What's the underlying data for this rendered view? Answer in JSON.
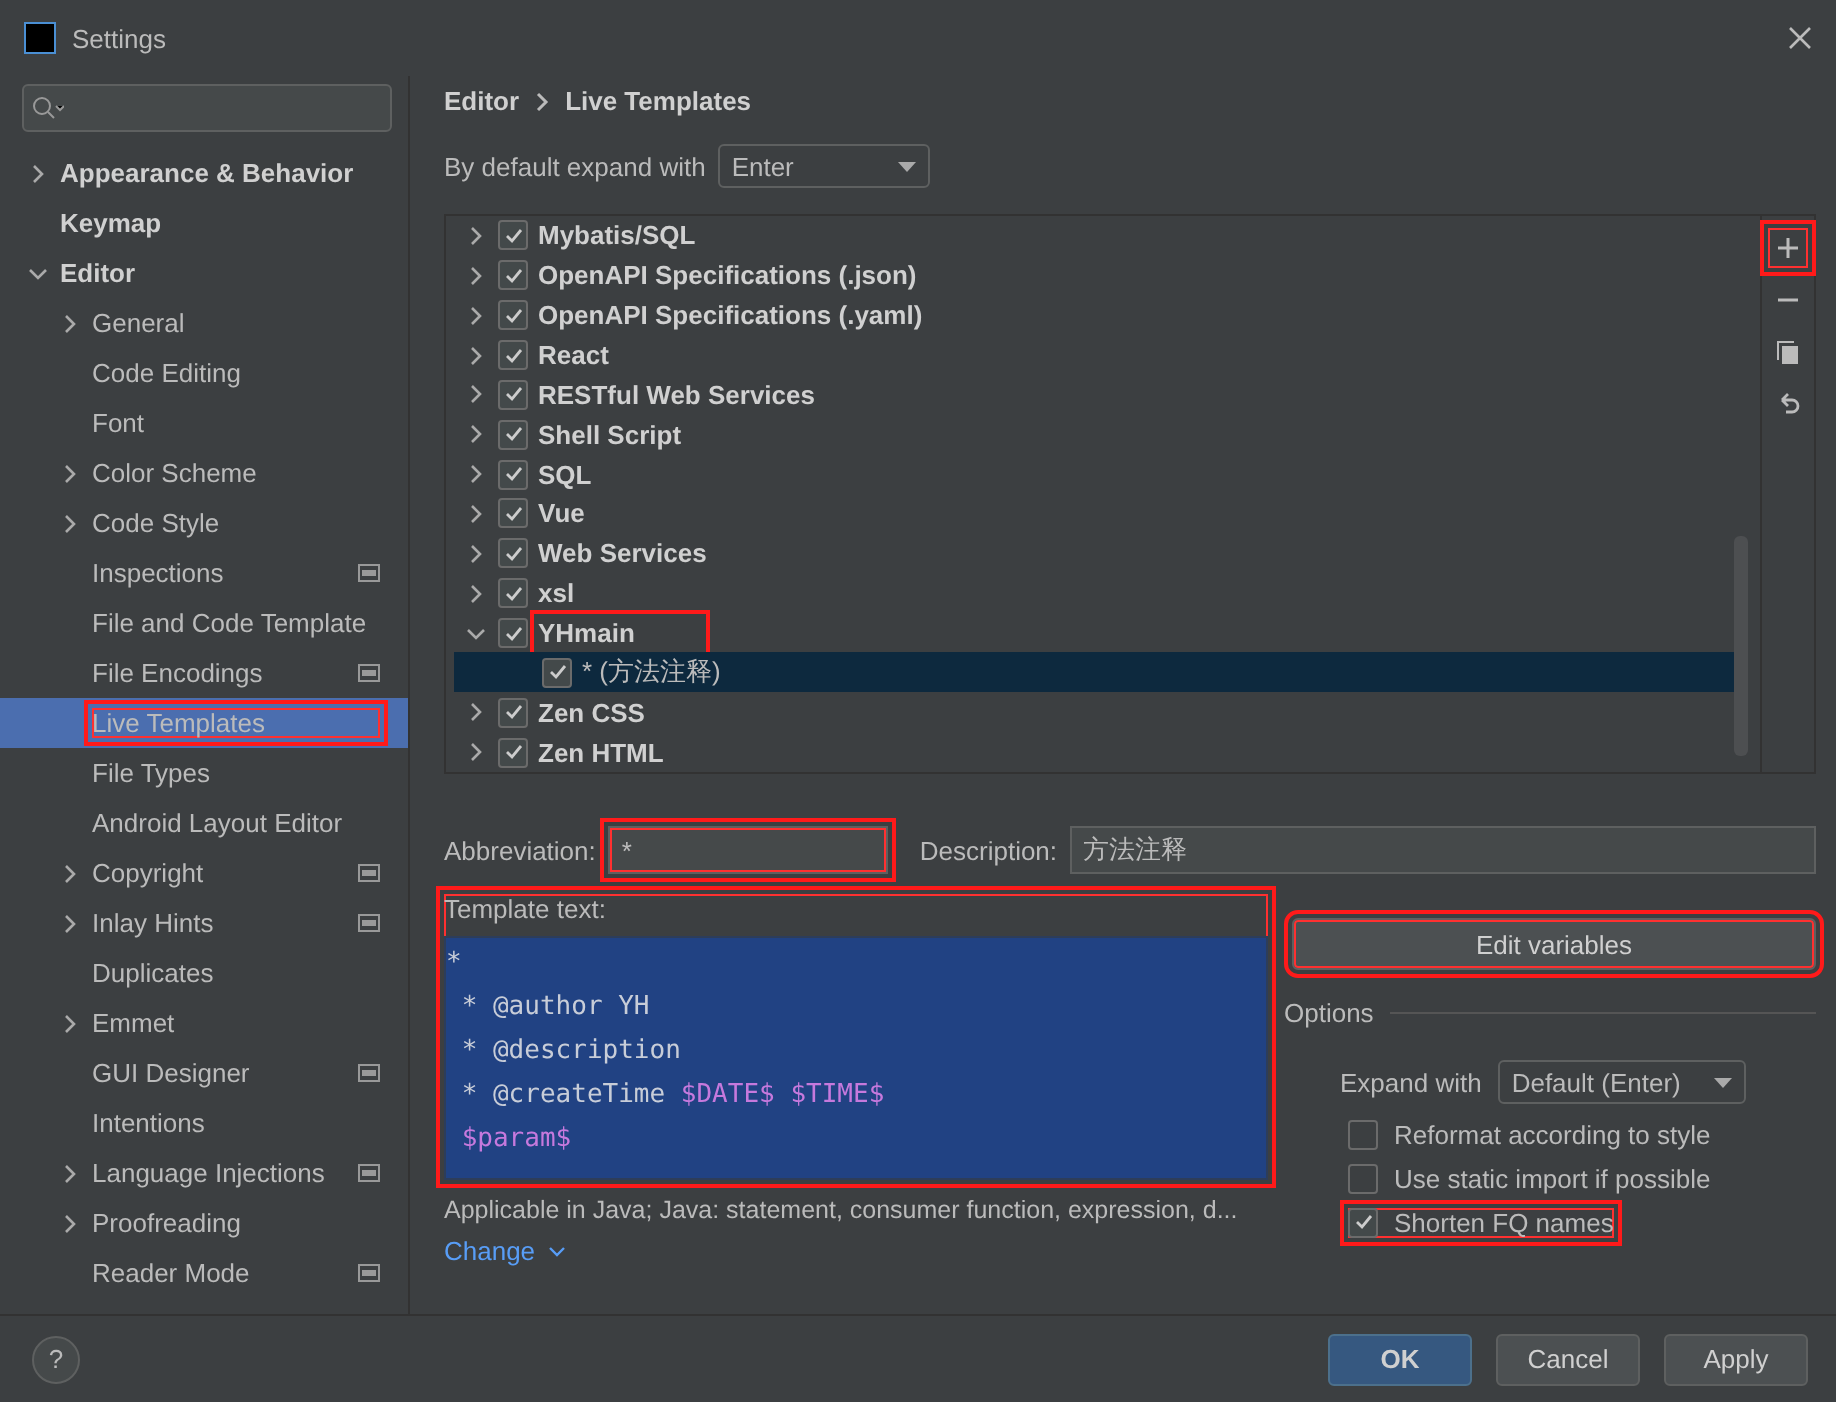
{
  "window": {
    "title": "Settings"
  },
  "sidebar": {
    "items": [
      {
        "label": "Appearance & Behavior",
        "expanded": false,
        "selected": false
      },
      {
        "label": "Keymap",
        "selected": false
      },
      {
        "label": "Editor",
        "expanded": true,
        "selected": false,
        "children": [
          {
            "label": "General",
            "expanded": false,
            "selected": false
          },
          {
            "label": "Code Editing",
            "selected": false
          },
          {
            "label": "Font",
            "selected": false
          },
          {
            "label": "Color Scheme",
            "expanded": false,
            "selected": false
          },
          {
            "label": "Code Style",
            "expanded": false,
            "selected": false
          },
          {
            "label": "Inspections",
            "selected": false,
            "scoped": true
          },
          {
            "label": "File and Code Template",
            "selected": false
          },
          {
            "label": "File Encodings",
            "selected": false,
            "scoped": true
          },
          {
            "label": "Live Templates",
            "selected": true,
            "highlighted": true
          },
          {
            "label": "File Types",
            "selected": false
          },
          {
            "label": "Android Layout Editor",
            "selected": false
          },
          {
            "label": "Copyright",
            "expanded": false,
            "selected": false,
            "scoped": true
          },
          {
            "label": "Inlay Hints",
            "expanded": false,
            "selected": false,
            "scoped": true
          },
          {
            "label": "Duplicates",
            "selected": false
          },
          {
            "label": "Emmet",
            "expanded": false,
            "selected": false
          },
          {
            "label": "GUI Designer",
            "selected": false,
            "scoped": true
          },
          {
            "label": "Intentions",
            "selected": false
          },
          {
            "label": "Language Injections",
            "expanded": false,
            "selected": false,
            "scoped": true
          },
          {
            "label": "Proofreading",
            "expanded": false,
            "selected": false
          },
          {
            "label": "Reader Mode",
            "selected": false,
            "scoped": true
          }
        ]
      }
    ]
  },
  "breadcrumb": [
    "Editor",
    "Live Templates"
  ],
  "expand_default": {
    "label": "By default expand with",
    "value": "Enter"
  },
  "templates": [
    {
      "label": "Mybatis/SQL",
      "checked": true,
      "expanded": false,
      "selected": false
    },
    {
      "label": "OpenAPI Specifications (.json)",
      "checked": true,
      "expanded": false,
      "selected": false
    },
    {
      "label": "OpenAPI Specifications (.yaml)",
      "checked": true,
      "expanded": false,
      "selected": false
    },
    {
      "label": "React",
      "checked": true,
      "expanded": false,
      "selected": false
    },
    {
      "label": "RESTful Web Services",
      "checked": true,
      "expanded": false,
      "selected": false
    },
    {
      "label": "Shell Script",
      "checked": true,
      "expanded": false,
      "selected": false
    },
    {
      "label": "SQL",
      "checked": true,
      "expanded": false,
      "selected": false
    },
    {
      "label": "Vue",
      "checked": true,
      "expanded": false,
      "selected": false
    },
    {
      "label": "Web Services",
      "checked": true,
      "expanded": false,
      "selected": false
    },
    {
      "label": "xsl",
      "checked": true,
      "expanded": false,
      "selected": false
    },
    {
      "label": "YHmain",
      "checked": true,
      "expanded": true,
      "selected": false,
      "highlighted": true,
      "children": [
        {
          "label": "* (方法注释)",
          "checked": true,
          "selected": true
        }
      ]
    },
    {
      "label": "Zen CSS",
      "checked": true,
      "expanded": false,
      "selected": false
    },
    {
      "label": "Zen HTML",
      "checked": true,
      "expanded": false,
      "selected": false
    }
  ],
  "tree_toolbar": [
    {
      "kind": "add",
      "highlighted": true
    },
    {
      "kind": "remove"
    },
    {
      "kind": "copy"
    },
    {
      "kind": "revert"
    }
  ],
  "abbreviation": {
    "label": "Abbreviation:",
    "value": "*",
    "highlighted": true
  },
  "description": {
    "label": "Description:",
    "value": "方法注释"
  },
  "template_text": {
    "label": "Template text:",
    "highlighted": true,
    "lines": [
      {
        "kind": "plain",
        "text": "*"
      },
      {
        "kind": "plain",
        "text": " * @author YH"
      },
      {
        "kind": "plain",
        "text": " * @description"
      },
      {
        "kind": "mixed",
        "text": " * @createTime ",
        "vars": "$DATE$ $TIME$"
      },
      {
        "kind": "var",
        "text": " $param$"
      }
    ]
  },
  "applicable": "Applicable in Java; Java: statement, consumer function, expression, d...",
  "change_link": "Change",
  "edit_variables": {
    "label": "Edit variables",
    "highlighted": true
  },
  "options": {
    "title": "Options",
    "expand_with": {
      "label": "Expand with",
      "value": "Default (Enter)"
    },
    "checks": [
      {
        "label": "Reformat according to style",
        "checked": false
      },
      {
        "label": "Use static import if possible",
        "checked": false
      },
      {
        "label": "Shorten FQ names",
        "checked": true,
        "highlighted": true
      }
    ]
  },
  "footer": {
    "help": "?",
    "buttons": [
      {
        "label": "OK",
        "primary": true
      },
      {
        "label": "Cancel",
        "primary": false
      },
      {
        "label": "Apply",
        "primary": false
      }
    ]
  }
}
